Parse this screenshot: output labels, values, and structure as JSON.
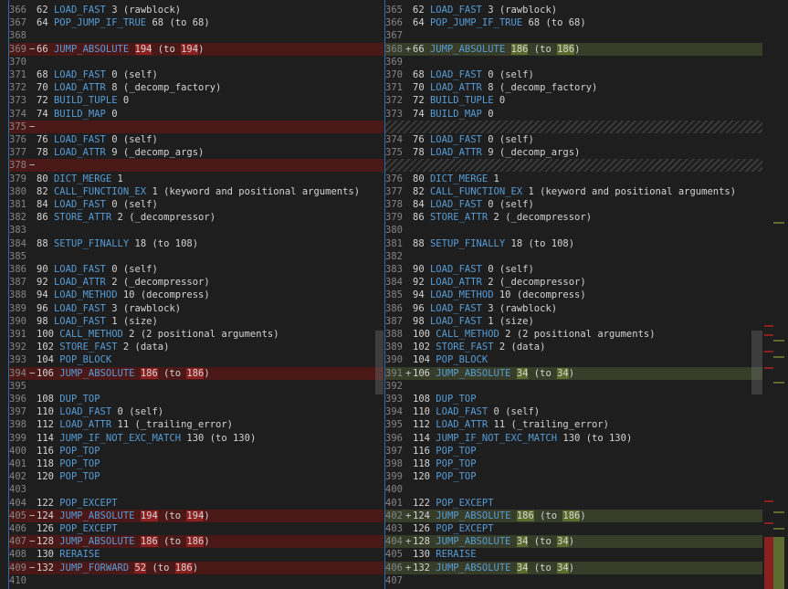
{
  "colors": {
    "background": "#1e1e1e",
    "removed_line": "#4b1818",
    "added_line": "#373d29",
    "removed_highlight": "#8a2020",
    "added_highlight": "#5c6b2e",
    "opcode": "#569cd6",
    "line_number": "#858585",
    "separator": "#2d6ea8"
  },
  "left_pane": {
    "lines": [
      {
        "ln": "366",
        "mk": "",
        "off": "62",
        "op": "LOAD_FAST",
        "arg": "3",
        "note": "(rawblock)"
      },
      {
        "ln": "367",
        "mk": "",
        "off": "64",
        "op": "POP_JUMP_IF_TRUE",
        "arg": "68",
        "note": "(to 68)"
      },
      {
        "ln": "368",
        "mk": "",
        "off": "",
        "op": "",
        "arg": "",
        "note": ""
      },
      {
        "ln": "369",
        "mk": "−",
        "off": "66",
        "op": "JUMP_ABSOLUTE",
        "arg": "194",
        "note": "(to 194)",
        "type": "removed",
        "hl": [
          "194",
          "194"
        ]
      },
      {
        "ln": "370",
        "mk": "",
        "off": "",
        "op": "",
        "arg": "",
        "note": ""
      },
      {
        "ln": "371",
        "mk": "",
        "off": "68",
        "op": "LOAD_FAST",
        "arg": "0",
        "note": "(self)"
      },
      {
        "ln": "372",
        "mk": "",
        "off": "70",
        "op": "LOAD_ATTR",
        "arg": "8",
        "note": "(_decomp_factory)"
      },
      {
        "ln": "373",
        "mk": "",
        "off": "72",
        "op": "BUILD_TUPLE",
        "arg": "0",
        "note": ""
      },
      {
        "ln": "374",
        "mk": "",
        "off": "74",
        "op": "BUILD_MAP",
        "arg": "0",
        "note": ""
      },
      {
        "ln": "375",
        "mk": "−",
        "off": "",
        "op": "",
        "arg": "",
        "note": "",
        "type": "removed"
      },
      {
        "ln": "376",
        "mk": "",
        "off": "76",
        "op": "LOAD_FAST",
        "arg": "0",
        "note": "(self)"
      },
      {
        "ln": "377",
        "mk": "",
        "off": "78",
        "op": "LOAD_ATTR",
        "arg": "9",
        "note": "(_decomp_args)"
      },
      {
        "ln": "378",
        "mk": "−",
        "off": "",
        "op": "",
        "arg": "",
        "note": "",
        "type": "removed"
      },
      {
        "ln": "379",
        "mk": "",
        "off": "80",
        "op": "DICT_MERGE",
        "arg": "1",
        "note": ""
      },
      {
        "ln": "380",
        "mk": "",
        "off": "82",
        "op": "CALL_FUNCTION_EX",
        "arg": "1",
        "note": "(keyword and positional arguments)"
      },
      {
        "ln": "381",
        "mk": "",
        "off": "84",
        "op": "LOAD_FAST",
        "arg": "0",
        "note": "(self)"
      },
      {
        "ln": "382",
        "mk": "",
        "off": "86",
        "op": "STORE_ATTR",
        "arg": "2",
        "note": "(_decompressor)"
      },
      {
        "ln": "383",
        "mk": "",
        "off": "",
        "op": "",
        "arg": "",
        "note": ""
      },
      {
        "ln": "384",
        "mk": "",
        "off": "88",
        "op": "SETUP_FINALLY",
        "arg": "18",
        "note": "(to 108)"
      },
      {
        "ln": "385",
        "mk": "",
        "off": "",
        "op": "",
        "arg": "",
        "note": ""
      },
      {
        "ln": "386",
        "mk": "",
        "off": "90",
        "op": "LOAD_FAST",
        "arg": "0",
        "note": "(self)"
      },
      {
        "ln": "387",
        "mk": "",
        "off": "92",
        "op": "LOAD_ATTR",
        "arg": "2",
        "note": "(_decompressor)"
      },
      {
        "ln": "388",
        "mk": "",
        "off": "94",
        "op": "LOAD_METHOD",
        "arg": "10",
        "note": "(decompress)"
      },
      {
        "ln": "389",
        "mk": "",
        "off": "96",
        "op": "LOAD_FAST",
        "arg": "3",
        "note": "(rawblock)"
      },
      {
        "ln": "390",
        "mk": "",
        "off": "98",
        "op": "LOAD_FAST",
        "arg": "1",
        "note": "(size)"
      },
      {
        "ln": "391",
        "mk": "",
        "off": "100",
        "op": "CALL_METHOD",
        "arg": "2",
        "note": "(2 positional arguments)"
      },
      {
        "ln": "392",
        "mk": "",
        "off": "102",
        "op": "STORE_FAST",
        "arg": "2",
        "note": "(data)"
      },
      {
        "ln": "393",
        "mk": "",
        "off": "104",
        "op": "POP_BLOCK",
        "arg": "",
        "note": ""
      },
      {
        "ln": "394",
        "mk": "−",
        "off": "106",
        "op": "JUMP_ABSOLUTE",
        "arg": "186",
        "note": "(to 186)",
        "type": "removed",
        "hl": [
          "186",
          "186"
        ]
      },
      {
        "ln": "395",
        "mk": "",
        "off": "",
        "op": "",
        "arg": "",
        "note": ""
      },
      {
        "ln": "396",
        "mk": "",
        "off": "108",
        "op": "DUP_TOP",
        "arg": "",
        "note": ""
      },
      {
        "ln": "397",
        "mk": "",
        "off": "110",
        "op": "LOAD_FAST",
        "arg": "0",
        "note": "(self)"
      },
      {
        "ln": "398",
        "mk": "",
        "off": "112",
        "op": "LOAD_ATTR",
        "arg": "11",
        "note": "(_trailing_error)"
      },
      {
        "ln": "399",
        "mk": "",
        "off": "114",
        "op": "JUMP_IF_NOT_EXC_MATCH",
        "arg": "130",
        "note": "(to 130)"
      },
      {
        "ln": "400",
        "mk": "",
        "off": "116",
        "op": "POP_TOP",
        "arg": "",
        "note": ""
      },
      {
        "ln": "401",
        "mk": "",
        "off": "118",
        "op": "POP_TOP",
        "arg": "",
        "note": ""
      },
      {
        "ln": "402",
        "mk": "",
        "off": "120",
        "op": "POP_TOP",
        "arg": "",
        "note": ""
      },
      {
        "ln": "403",
        "mk": "",
        "off": "",
        "op": "",
        "arg": "",
        "note": ""
      },
      {
        "ln": "404",
        "mk": "",
        "off": "122",
        "op": "POP_EXCEPT",
        "arg": "",
        "note": ""
      },
      {
        "ln": "405",
        "mk": "−",
        "off": "124",
        "op": "JUMP_ABSOLUTE",
        "arg": "194",
        "note": "(to 194)",
        "type": "removed",
        "hl": [
          "194",
          "194"
        ]
      },
      {
        "ln": "406",
        "mk": "",
        "off": "126",
        "op": "POP_EXCEPT",
        "arg": "",
        "note": ""
      },
      {
        "ln": "407",
        "mk": "−",
        "off": "128",
        "op": "JUMP_ABSOLUTE",
        "arg": "186",
        "note": "(to 186)",
        "type": "removed",
        "hl": [
          "186",
          "186"
        ]
      },
      {
        "ln": "408",
        "mk": "",
        "off": "130",
        "op": "RERAISE",
        "arg": "",
        "note": ""
      },
      {
        "ln": "409",
        "mk": "−",
        "off": "132",
        "op": "JUMP_FORWARD",
        "arg": "52",
        "note": "(to 186)",
        "type": "removed",
        "hl": [
          "52",
          "186"
        ]
      },
      {
        "ln": "410",
        "mk": "",
        "off": "",
        "op": "",
        "arg": "",
        "note": ""
      }
    ]
  },
  "right_pane": {
    "lines": [
      {
        "ln": "365",
        "mk": "",
        "off": "62",
        "op": "LOAD_FAST",
        "arg": "3",
        "note": "(rawblock)"
      },
      {
        "ln": "366",
        "mk": "",
        "off": "64",
        "op": "POP_JUMP_IF_TRUE",
        "arg": "68",
        "note": "(to 68)"
      },
      {
        "ln": "367",
        "mk": "",
        "off": "",
        "op": "",
        "arg": "",
        "note": ""
      },
      {
        "ln": "368",
        "mk": "+",
        "off": "66",
        "op": "JUMP_ABSOLUTE",
        "arg": "186",
        "note": "(to 186)",
        "type": "added",
        "hl": [
          "186",
          "186"
        ]
      },
      {
        "ln": "369",
        "mk": "",
        "off": "",
        "op": "",
        "arg": "",
        "note": ""
      },
      {
        "ln": "370",
        "mk": "",
        "off": "68",
        "op": "LOAD_FAST",
        "arg": "0",
        "note": "(self)"
      },
      {
        "ln": "371",
        "mk": "",
        "off": "70",
        "op": "LOAD_ATTR",
        "arg": "8",
        "note": "(_decomp_factory)"
      },
      {
        "ln": "372",
        "mk": "",
        "off": "72",
        "op": "BUILD_TUPLE",
        "arg": "0",
        "note": ""
      },
      {
        "ln": "373",
        "mk": "",
        "off": "74",
        "op": "BUILD_MAP",
        "arg": "0",
        "note": ""
      },
      {
        "ln": "",
        "mk": "",
        "off": "",
        "op": "",
        "arg": "",
        "note": "",
        "type": "gap"
      },
      {
        "ln": "374",
        "mk": "",
        "off": "76",
        "op": "LOAD_FAST",
        "arg": "0",
        "note": "(self)"
      },
      {
        "ln": "375",
        "mk": "",
        "off": "78",
        "op": "LOAD_ATTR",
        "arg": "9",
        "note": "(_decomp_args)"
      },
      {
        "ln": "",
        "mk": "",
        "off": "",
        "op": "",
        "arg": "",
        "note": "",
        "type": "gap"
      },
      {
        "ln": "376",
        "mk": "",
        "off": "80",
        "op": "DICT_MERGE",
        "arg": "1",
        "note": ""
      },
      {
        "ln": "377",
        "mk": "",
        "off": "82",
        "op": "CALL_FUNCTION_EX",
        "arg": "1",
        "note": "(keyword and positional arguments)"
      },
      {
        "ln": "378",
        "mk": "",
        "off": "84",
        "op": "LOAD_FAST",
        "arg": "0",
        "note": "(self)"
      },
      {
        "ln": "379",
        "mk": "",
        "off": "86",
        "op": "STORE_ATTR",
        "arg": "2",
        "note": "(_decompressor)"
      },
      {
        "ln": "380",
        "mk": "",
        "off": "",
        "op": "",
        "arg": "",
        "note": ""
      },
      {
        "ln": "381",
        "mk": "",
        "off": "88",
        "op": "SETUP_FINALLY",
        "arg": "18",
        "note": "(to 108)"
      },
      {
        "ln": "382",
        "mk": "",
        "off": "",
        "op": "",
        "arg": "",
        "note": ""
      },
      {
        "ln": "383",
        "mk": "",
        "off": "90",
        "op": "LOAD_FAST",
        "arg": "0",
        "note": "(self)"
      },
      {
        "ln": "384",
        "mk": "",
        "off": "92",
        "op": "LOAD_ATTR",
        "arg": "2",
        "note": "(_decompressor)"
      },
      {
        "ln": "385",
        "mk": "",
        "off": "94",
        "op": "LOAD_METHOD",
        "arg": "10",
        "note": "(decompress)"
      },
      {
        "ln": "386",
        "mk": "",
        "off": "96",
        "op": "LOAD_FAST",
        "arg": "3",
        "note": "(rawblock)"
      },
      {
        "ln": "387",
        "mk": "",
        "off": "98",
        "op": "LOAD_FAST",
        "arg": "1",
        "note": "(size)"
      },
      {
        "ln": "388",
        "mk": "",
        "off": "100",
        "op": "CALL_METHOD",
        "arg": "2",
        "note": "(2 positional arguments)"
      },
      {
        "ln": "389",
        "mk": "",
        "off": "102",
        "op": "STORE_FAST",
        "arg": "2",
        "note": "(data)"
      },
      {
        "ln": "390",
        "mk": "",
        "off": "104",
        "op": "POP_BLOCK",
        "arg": "",
        "note": ""
      },
      {
        "ln": "391",
        "mk": "+",
        "off": "106",
        "op": "JUMP_ABSOLUTE",
        "arg": "34",
        "note": "(to 34)",
        "type": "added",
        "hl": [
          "34",
          "34"
        ]
      },
      {
        "ln": "392",
        "mk": "",
        "off": "",
        "op": "",
        "arg": "",
        "note": ""
      },
      {
        "ln": "393",
        "mk": "",
        "off": "108",
        "op": "DUP_TOP",
        "arg": "",
        "note": ""
      },
      {
        "ln": "394",
        "mk": "",
        "off": "110",
        "op": "LOAD_FAST",
        "arg": "0",
        "note": "(self)"
      },
      {
        "ln": "395",
        "mk": "",
        "off": "112",
        "op": "LOAD_ATTR",
        "arg": "11",
        "note": "(_trailing_error)"
      },
      {
        "ln": "396",
        "mk": "",
        "off": "114",
        "op": "JUMP_IF_NOT_EXC_MATCH",
        "arg": "130",
        "note": "(to 130)"
      },
      {
        "ln": "397",
        "mk": "",
        "off": "116",
        "op": "POP_TOP",
        "arg": "",
        "note": ""
      },
      {
        "ln": "398",
        "mk": "",
        "off": "118",
        "op": "POP_TOP",
        "arg": "",
        "note": ""
      },
      {
        "ln": "399",
        "mk": "",
        "off": "120",
        "op": "POP_TOP",
        "arg": "",
        "note": ""
      },
      {
        "ln": "400",
        "mk": "",
        "off": "",
        "op": "",
        "arg": "",
        "note": ""
      },
      {
        "ln": "401",
        "mk": "",
        "off": "122",
        "op": "POP_EXCEPT",
        "arg": "",
        "note": ""
      },
      {
        "ln": "402",
        "mk": "+",
        "off": "124",
        "op": "JUMP_ABSOLUTE",
        "arg": "186",
        "note": "(to 186)",
        "type": "added",
        "hl": [
          "186",
          "186"
        ]
      },
      {
        "ln": "403",
        "mk": "",
        "off": "126",
        "op": "POP_EXCEPT",
        "arg": "",
        "note": ""
      },
      {
        "ln": "404",
        "mk": "+",
        "off": "128",
        "op": "JUMP_ABSOLUTE",
        "arg": "34",
        "note": "(to 34)",
        "type": "added",
        "hl": [
          "34",
          "34"
        ]
      },
      {
        "ln": "405",
        "mk": "",
        "off": "130",
        "op": "RERAISE",
        "arg": "",
        "note": ""
      },
      {
        "ln": "406",
        "mk": "+",
        "off": "132",
        "op": "JUMP_ABSOLUTE",
        "arg": "34",
        "note": "(to 34)",
        "type": "added",
        "hl": [
          "34",
          "34"
        ]
      },
      {
        "ln": "407",
        "mk": "",
        "off": "",
        "op": "",
        "arg": "",
        "note": ""
      }
    ]
  }
}
